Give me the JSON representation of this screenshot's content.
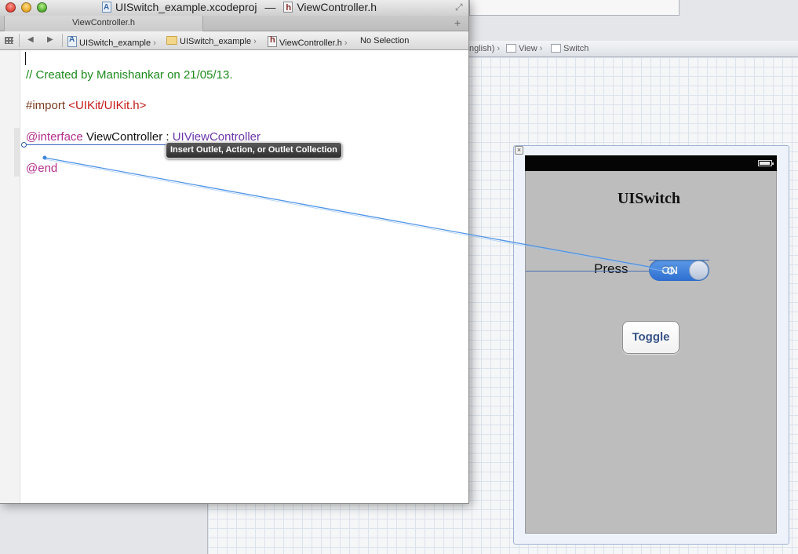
{
  "window": {
    "project_file": "UISwitch_example.xcodeproj",
    "title_separator": "—",
    "header_file": "ViewController.h"
  },
  "tab": {
    "label": "ViewController.h"
  },
  "jumpbar": {
    "project": "UISwitch_example",
    "group": "UISwitch_example",
    "file": "ViewController.h",
    "selection": "No Selection"
  },
  "code": {
    "comment": "//  Created by Manishankar on 21/05/13.",
    "import_kw": "#import",
    "import_path": "<UIKit/UIKit.h>",
    "interface_kw": "@interface",
    "class_name": "ViewController",
    "colon": ":",
    "superclass": "UIViewController",
    "end_kw": "@end"
  },
  "tooltip": {
    "text": "Insert Outlet, Action, or Outlet Collection"
  },
  "ib_jumpbar": {
    "partial": "nglish)",
    "view": "View",
    "switch": "Switch"
  },
  "scene": {
    "title": "UISwitch",
    "press_label": "Press",
    "switch_state": "ON",
    "toggle_button": "Toggle"
  },
  "colors": {
    "comment": "#1d8a1d",
    "keyword": "#b1308f",
    "string": "#c41a16",
    "class": "#6c36a9",
    "switch_on": "#2d6ed1",
    "connection_line": "#4f93e6"
  }
}
